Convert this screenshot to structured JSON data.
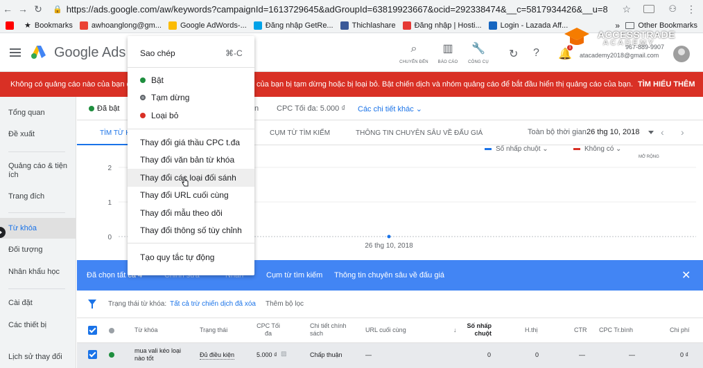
{
  "browser": {
    "url": "https://ads.google.com/aw/keywords?campaignId=1613729645&adGroupId=63819923667&ocid=292338474&__c=5817934426&__u=8426227478...",
    "bookmarks": [
      "Bookmarks",
      "awhoanglong@gm...",
      "Google AdWords-...",
      "Đăng nhập GetRe...",
      "Thichlashare",
      "Đăng nhập | Hosti...",
      "Login - Lazada Aff..."
    ],
    "bookmarks_more": "»",
    "other_bookmarks": "Other Bookmarks"
  },
  "header": {
    "brand": "Google Ads",
    "tools": [
      "CHUYỂN ĐẾN",
      "BÁO CÁO",
      "CÔNG CỤ"
    ],
    "notification_count": "1",
    "account_phone": "967-889-9907",
    "account_email": "atacademy2018@gmail.com"
  },
  "watermark": {
    "line1": "ACCESSTRADE",
    "line2": "ACADEMY"
  },
  "alert": {
    "text_left": "Không có quảng cáo nào của bạn đa",
    "text_right": "của bạn bị tạm dừng hoặc bị loại bỏ. Bật chiến dịch và nhóm quảng cáo để bắt đầu hiển thị quảng cáo của bạn.",
    "action": "TÌM HIỂU THÊM"
  },
  "sidebar": {
    "items": [
      "Tổng quan",
      "Đề xuất",
      "Quảng cáo & tiện ích",
      "Trang đích",
      "Từ khóa",
      "Đối tượng",
      "Nhân khẩu học",
      "Cài đặt",
      "Các thiết bị",
      "Lịch sử thay đổi"
    ],
    "active": "Từ khóa"
  },
  "filterbar": {
    "status": "Đã bật",
    "fragment": "n",
    "cpc": "CPC Tối đa: 5.000 ₫",
    "details": "Các chi tiết khác"
  },
  "tabs": {
    "items": [
      "TÌM TỪ K",
      "CỤM TỪ TÌM KIẾM",
      "THÔNG TIN CHUYÊN SÂU VỀ ĐẤU GIÁ"
    ],
    "date_label": "Toàn bộ thời gian",
    "date_value": "26 thg 10, 2018"
  },
  "chart_data": {
    "type": "line",
    "x": [
      "26 thg 10, 2018"
    ],
    "series": [
      {
        "name": "Số nhấp chuột",
        "values": [
          0
        ]
      }
    ],
    "ylim": [
      0,
      2
    ],
    "yticks": [
      0,
      1,
      2
    ],
    "legend": [
      "Số nhấp chuột",
      "Không có"
    ],
    "tools": "MỞ RỘNG"
  },
  "selection_bar": {
    "selected": "Đã chọn tất cả 4",
    "edit": "Chỉnh sửa",
    "label": "Nhãn",
    "search_terms": "Cụm từ tìm kiếm",
    "auction": "Thông tin chuyên sâu về đấu giá"
  },
  "filter_line": {
    "prefix": "Trạng thái từ khóa:",
    "value": "Tất cả trừ chiến dịch đã xóa",
    "add": "Thêm bộ lọc"
  },
  "table": {
    "headers": [
      "Từ khóa",
      "Trạng thái",
      "CPC Tối đa",
      "Chi tiết chính sách",
      "URL cuối cùng",
      "Số nhấp chuột",
      "H.thị",
      "CTR",
      "CPC Tr.bình",
      "Chi phí"
    ],
    "rows": [
      [
        "mua vali kéo loại nào tốt",
        "Đủ điều kiện",
        "5.000 ₫",
        "Chấp thuận",
        "—",
        "0",
        "0",
        "—",
        "—",
        "0 ₫"
      ]
    ]
  },
  "context_menu": {
    "copy": "Sao chép",
    "copy_shortcut": "⌘-C",
    "enable": "Bật",
    "pause": "Tạm dừng",
    "remove": "Loại bỏ",
    "actions": [
      "Thay đổi giá thầu CPC t.đa",
      "Thay đổi văn bản từ khóa",
      "Thay đổi các loại đối sánh",
      "Thay đổi URL cuối cùng",
      "Thay đổi mẫu theo dõi",
      "Thay đổi thông số tùy chỉnh"
    ],
    "highlighted": "Thay đổi các loại đối sánh",
    "auto_rule": "Tạo quy tắc tự động"
  },
  "colors": {
    "alert": "#d93025",
    "accent": "#1a73e8",
    "selection": "#4285f4",
    "enabled": "#1e8e3e"
  }
}
